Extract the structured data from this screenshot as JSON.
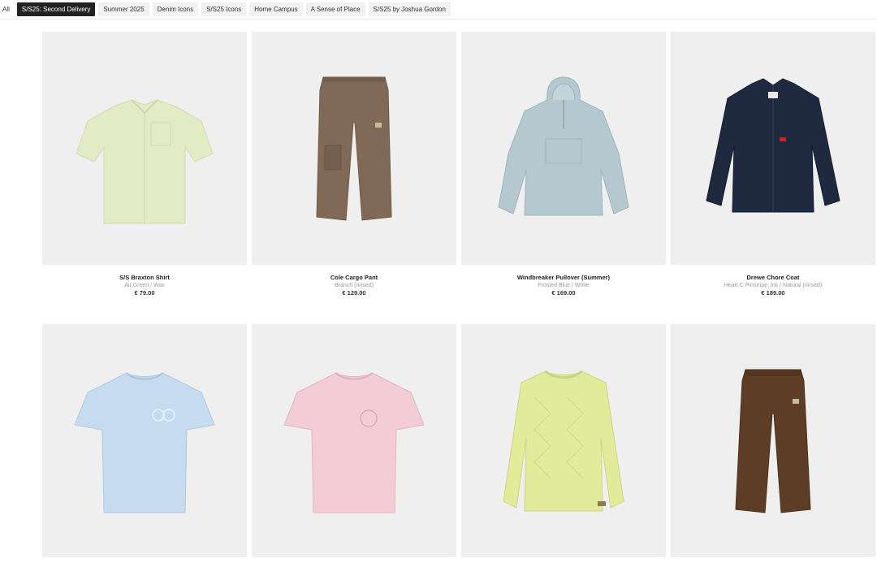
{
  "filters": [
    {
      "label": "All",
      "active": false
    },
    {
      "label": "S/S25: Second Delivery",
      "active": true
    },
    {
      "label": "Summer 2025",
      "active": false
    },
    {
      "label": "Denim Icons",
      "active": false
    },
    {
      "label": "S/S25 Icons",
      "active": false
    },
    {
      "label": "Home Campus",
      "active": false
    },
    {
      "label": "A Sense of Place",
      "active": false
    },
    {
      "label": "S/S25 by Joshua Gordon",
      "active": false
    }
  ],
  "products": [
    {
      "name": "S/S Braxton Shirt",
      "color": "Air Green / Wax",
      "price": "€ 79.00",
      "swatch": "#e3ebc5",
      "icon": "shirt-icon"
    },
    {
      "name": "Cole Cargo Pant",
      "color": "Branch (rinsed)",
      "price": "€ 129.00",
      "swatch": "#806a57",
      "icon": "cargo-pant-icon"
    },
    {
      "name": "Windbreaker Pullover (Summer)",
      "color": "Frosted Blue / White",
      "price": "€ 169.00",
      "swatch": "#b3c8cf",
      "icon": "pullover-icon"
    },
    {
      "name": "Drewe Chore Coat",
      "color": "Heart C Pinstripe, Ink / Natural (rinsed)",
      "price": "€ 189.00",
      "swatch": "#1f2a40",
      "icon": "chore-coat-icon"
    },
    {
      "name": "",
      "color": "",
      "price": "",
      "swatch": "#c5dcf0",
      "icon": "tshirt-icon"
    },
    {
      "name": "",
      "color": "",
      "price": "",
      "swatch": "#f3ccd5",
      "icon": "tshirt-icon"
    },
    {
      "name": "",
      "color": "",
      "price": "",
      "swatch": "#e2eb99",
      "icon": "sweater-icon"
    },
    {
      "name": "",
      "color": "",
      "price": "",
      "swatch": "#5e3d27",
      "icon": "pant-icon"
    }
  ]
}
